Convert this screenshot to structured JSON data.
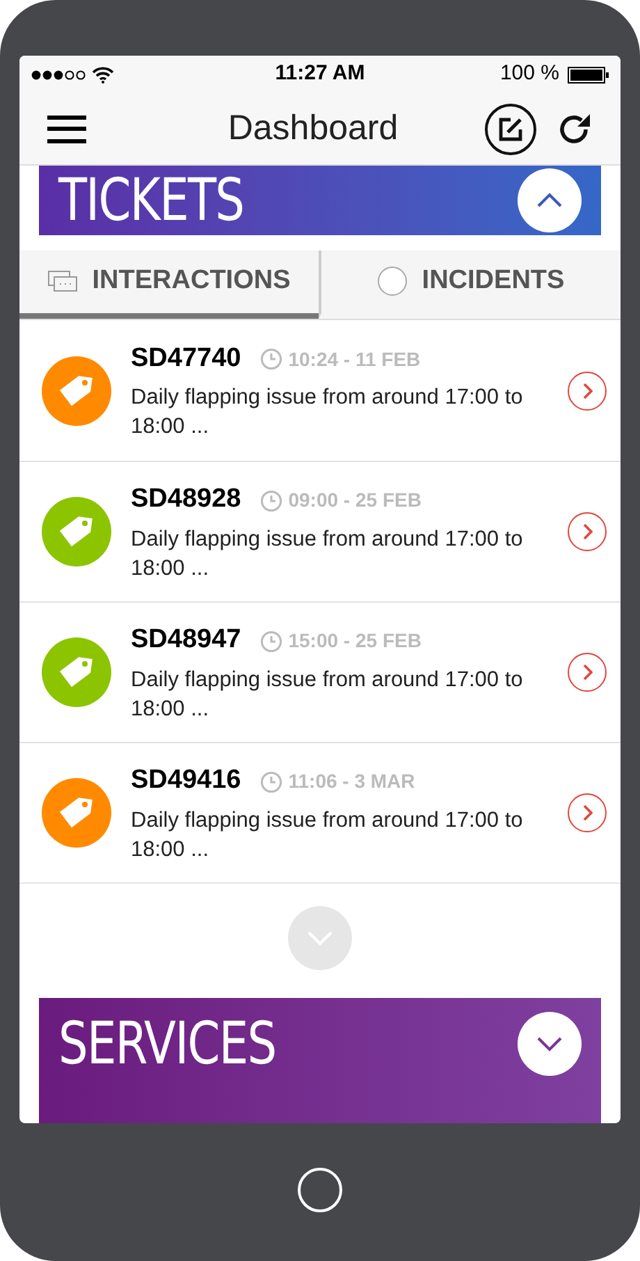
{
  "status_bar": {
    "time": "11:27 AM",
    "battery": "100 %"
  },
  "header": {
    "title": "Dashboard"
  },
  "sections": [
    {
      "title": "TICKETS",
      "expanded": true
    },
    {
      "title": "SERVICES",
      "expanded": false
    }
  ],
  "tabs": [
    {
      "label": "INTERACTIONS",
      "selected": true
    },
    {
      "label": "INCIDENTS",
      "selected": false
    }
  ],
  "tickets": [
    {
      "id": "SD47740",
      "time": "10:24 - 11 FEB",
      "summary": "Daily flapping issue from around 17:00 to 18:00 ...",
      "color": "#ff8a00"
    },
    {
      "id": "SD48928",
      "time": "09:00 - 25 FEB",
      "summary": "Daily flapping issue from around 17:00 to 18:00 ...",
      "color": "#8cc400"
    },
    {
      "id": "SD48947",
      "time": "15:00 - 25 FEB",
      "summary": "Daily flapping issue from around 17:00 to 18:00 ...",
      "color": "#8cc400"
    },
    {
      "id": "SD49416",
      "time": "11:06 - 3 MAR",
      "summary": "Daily flapping issue from around 17:00 to 18:00 ...",
      "color": "#ff8a00"
    }
  ]
}
